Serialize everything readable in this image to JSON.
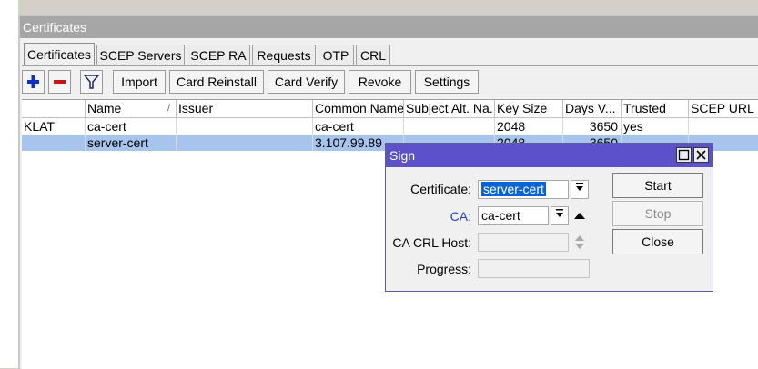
{
  "window": {
    "title": "Certificates"
  },
  "tabs": [
    {
      "label": "Certificates",
      "active": true
    },
    {
      "label": "SCEP Servers"
    },
    {
      "label": "SCEP RA"
    },
    {
      "label": "Requests"
    },
    {
      "label": "OTP"
    },
    {
      "label": "CRL"
    }
  ],
  "toolbar": {
    "add_icon": "plus-icon",
    "remove_icon": "minus-icon",
    "filter_icon": "filter-icon",
    "buttons": [
      "Import",
      "Card Reinstall",
      "Card Verify",
      "Revoke",
      "Settings"
    ]
  },
  "table": {
    "columns": [
      "Name",
      "Issuer",
      "Common Name",
      "Subject Alt. Na...",
      "Key Size",
      "Days V...",
      "Trusted",
      "SCEP URL"
    ],
    "rows": [
      {
        "flag": "KLAT",
        "name": "ca-cert",
        "issuer": "",
        "common_name": "ca-cert",
        "subject_alt": "",
        "key_size": "2048",
        "days_valid": "3650",
        "trusted": "yes",
        "scep_url": ""
      },
      {
        "flag": "",
        "name": "server-cert",
        "issuer": "",
        "common_name": "3.107.99.89",
        "subject_alt": "",
        "key_size": "2048",
        "days_valid": "3650",
        "trusted": "",
        "scep_url": "",
        "selected": true
      }
    ]
  },
  "dialog": {
    "title": "Sign",
    "certificate_label": "Certificate:",
    "certificate_value": "server-cert",
    "ca_label": "CA:",
    "ca_value": "ca-cert",
    "crl_host_label": "CA CRL Host:",
    "crl_host_value": "",
    "progress_label": "Progress:",
    "progress_value": "",
    "start_label": "Start",
    "stop_label": "Stop",
    "close_label": "Close"
  },
  "colors": {
    "dialog_title": "#5b52c9",
    "selection": "#a6c4ec",
    "ca_label": "#1f3fd0"
  }
}
